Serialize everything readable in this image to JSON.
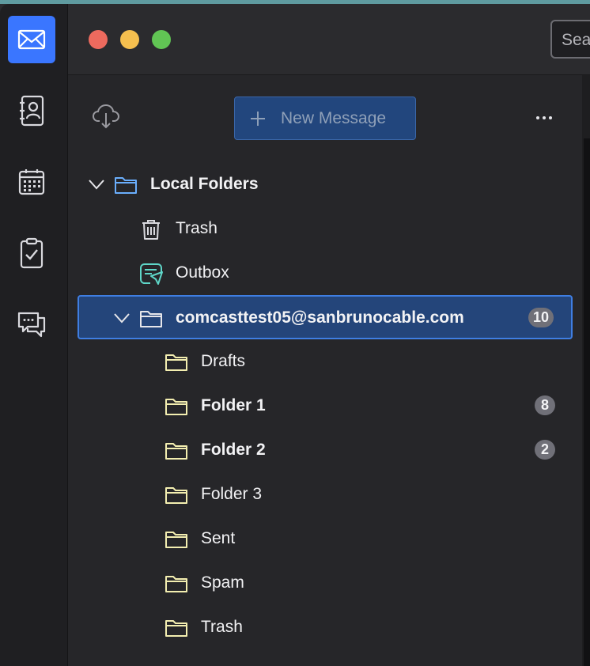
{
  "titlebar": {
    "search_placeholder": "Sea"
  },
  "spaces": [
    {
      "icon": "mail-icon",
      "label": "Mail",
      "active": true
    },
    {
      "icon": "address-book-icon",
      "label": "Address Book",
      "active": false
    },
    {
      "icon": "calendar-icon",
      "label": "Calendar",
      "active": false
    },
    {
      "icon": "tasks-icon",
      "label": "Tasks",
      "active": false
    },
    {
      "icon": "chat-icon",
      "label": "Chat",
      "active": false
    }
  ],
  "toolbar": {
    "new_message_label": "New Message"
  },
  "folders": {
    "local": {
      "label": "Local Folders",
      "children": [
        {
          "label": "Trash",
          "icon": "trash-icon"
        },
        {
          "label": "Outbox",
          "icon": "outbox-icon"
        }
      ]
    },
    "account": {
      "label": "comcasttest05@sanbrunocable.com",
      "unread": "10",
      "children": [
        {
          "label": "Drafts",
          "unread": ""
        },
        {
          "label": "Folder 1",
          "unread": "8"
        },
        {
          "label": "Folder 2",
          "unread": "2"
        },
        {
          "label": "Folder 3",
          "unread": ""
        },
        {
          "label": "Sent",
          "unread": ""
        },
        {
          "label": "Spam",
          "unread": ""
        },
        {
          "label": "Trash",
          "unread": ""
        }
      ]
    }
  },
  "colors": {
    "accent": "#3a76ff",
    "selection": "#24457a",
    "folder_icon": "#f3eeb0",
    "outbox_icon": "#5fd6c8"
  }
}
